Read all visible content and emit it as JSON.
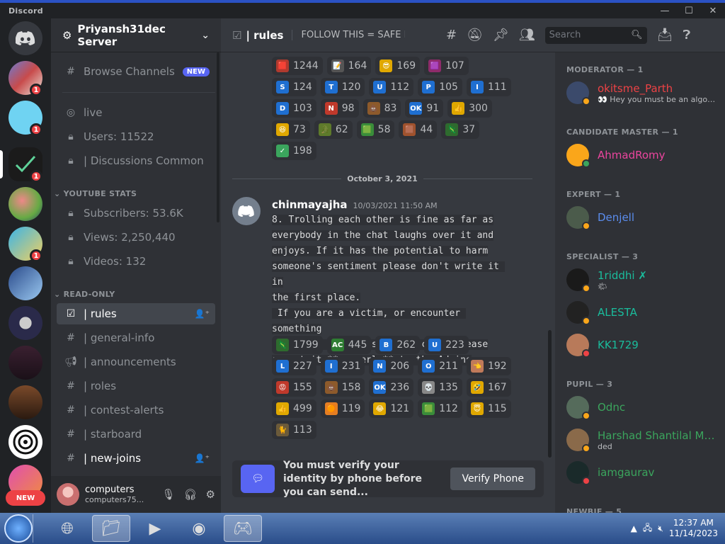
{
  "window": {
    "app_name": "Discord",
    "minimize": "—",
    "maximize": "☐",
    "close": "✕"
  },
  "server": {
    "name": "Priyansh31dec Server"
  },
  "rail": {
    "new_label": "NEW",
    "badges": [
      "1",
      "1",
      "1",
      "1"
    ]
  },
  "sidebar": {
    "browse": {
      "label": "Browse Channels",
      "tag": "NEW"
    },
    "channels_top": [
      {
        "label": "live"
      },
      {
        "label": "Users: 11522"
      },
      {
        "label": "| Discussions Common"
      }
    ],
    "cat_youtube": "YOUTUBE STATS",
    "youtube": [
      {
        "label": "Subscribers: 53.6K"
      },
      {
        "label": "Views: 2,250,440"
      },
      {
        "label": "Videos: 132"
      }
    ],
    "cat_readonly": "READ-ONLY",
    "readonly": [
      {
        "label": "| rules"
      },
      {
        "label": "| general-info"
      },
      {
        "label": "| announcements"
      },
      {
        "label": "| roles"
      },
      {
        "label": "| contest-alerts"
      },
      {
        "label": "| starboard"
      },
      {
        "label": "| new-joins"
      }
    ]
  },
  "user": {
    "name": "computers",
    "status": "computers75..."
  },
  "header": {
    "channel": "| rules",
    "topic": "FOLLOW THIS = SAFE D...",
    "search_placeholder": "Search"
  },
  "reactions_top": [
    [
      {
        "e": "🟥",
        "c": "#b03a2e",
        "v": "1244"
      },
      {
        "e": "📝",
        "c": "#555",
        "v": "164"
      },
      {
        "e": "😎",
        "c": "#e0a800",
        "v": "169"
      },
      {
        "e": "🟪",
        "c": "#8e2b6b",
        "v": "107"
      }
    ],
    [
      {
        "e": "S",
        "c": "#1f6fd1",
        "v": "124"
      },
      {
        "e": "T",
        "c": "#1f6fd1",
        "v": "120"
      },
      {
        "e": "U",
        "c": "#1f6fd1",
        "v": "112"
      },
      {
        "e": "P",
        "c": "#1f6fd1",
        "v": "105"
      },
      {
        "e": "I",
        "c": "#1f6fd1",
        "v": "111"
      }
    ],
    [
      {
        "e": "D",
        "c": "#1f6fd1",
        "v": "103"
      },
      {
        "e": "N",
        "c": "#c0392b",
        "v": "98"
      },
      {
        "e": "💩",
        "c": "#8d5a2b",
        "v": "83"
      },
      {
        "e": "OK",
        "c": "#1f6fd1",
        "v": "91"
      },
      {
        "e": "👍",
        "c": "#e0a800",
        "v": "300"
      }
    ],
    [
      {
        "e": "😆",
        "c": "#e0a800",
        "v": "73"
      },
      {
        "e": "🐊",
        "c": "#5e7a2b",
        "v": "62"
      },
      {
        "e": "🟩",
        "c": "#3a8d3a",
        "v": "58"
      },
      {
        "e": "🟫",
        "c": "#a0522d",
        "v": "44"
      },
      {
        "e": "🦎",
        "c": "#2e6b2e",
        "v": "37"
      }
    ],
    [
      {
        "e": "✓",
        "c": "#3ba55d",
        "v": "198"
      }
    ]
  ],
  "date_divider": "October 3, 2021",
  "message": {
    "author": "chinmayajha",
    "timestamp": "10/03/2021 11:50 AM",
    "lines": [
      "8. Trolling each other is fine as far as",
      "everybody in the chat laughs over it and",
      "enjoys. If it has the potential to harm",
      "someone's sentiment please don't write it in",
      "the first place.",
      " If you are a victim, or encounter something",
      "happening like this in the chat, please",
      "report it **properly** to the Admins"
    ]
  },
  "reactions_msg": [
    [
      {
        "e": "🦎",
        "c": "#2e6b2e",
        "v": "1799"
      },
      {
        "e": "AC",
        "c": "#2e7d32",
        "v": "445"
      },
      {
        "e": "B",
        "c": "#1f6fd1",
        "v": "262"
      },
      {
        "e": "U",
        "c": "#1f6fd1",
        "v": "223"
      }
    ],
    [
      {
        "e": "L",
        "c": "#1f6fd1",
        "v": "227"
      },
      {
        "e": "I",
        "c": "#1f6fd1",
        "v": "231"
      },
      {
        "e": "N",
        "c": "#1f6fd1",
        "v": "206"
      },
      {
        "e": "O",
        "c": "#1f6fd1",
        "v": "211"
      },
      {
        "e": "👈",
        "c": "#c07a5a",
        "v": "192"
      }
    ],
    [
      {
        "e": "😡",
        "c": "#c0392b",
        "v": "155"
      },
      {
        "e": "💩",
        "c": "#8d5a2b",
        "v": "158"
      },
      {
        "e": "OK",
        "c": "#1f6fd1",
        "v": "236"
      },
      {
        "e": "💀",
        "c": "#888",
        "v": "135"
      },
      {
        "e": "🤣",
        "c": "#e0a800",
        "v": "167"
      }
    ],
    [
      {
        "e": "👍",
        "c": "#e0a800",
        "v": "499"
      },
      {
        "e": "🟠",
        "c": "#e67e22",
        "v": "119"
      },
      {
        "e": "😂",
        "c": "#e0a800",
        "v": "121"
      },
      {
        "e": "🟩",
        "c": "#3a8d3a",
        "v": "112"
      },
      {
        "e": "😇",
        "c": "#e0a800",
        "v": "115"
      }
    ],
    [
      {
        "e": "🐈",
        "c": "#6b5a3a",
        "v": "113"
      }
    ]
  ],
  "verify": {
    "text": "You must verify your identity by phone before you can send...",
    "button": "Verify Phone"
  },
  "members": {
    "groups": [
      {
        "title": "MODERATOR — 1",
        "items": [
          {
            "name": "okitsme_Parth",
            "color": "#ed4245",
            "status_text": "👀 Hey you must be an algorit...",
            "av": "#3b4a6b",
            "st": "#faa61a"
          }
        ]
      },
      {
        "title": "CANDIDATE MASTER — 1",
        "items": [
          {
            "name": "AhmadRomy",
            "color": "#eb459e",
            "status_text": "",
            "av": "#faa61a",
            "st": "#3ba55d"
          }
        ]
      },
      {
        "title": "EXPERT — 1",
        "items": [
          {
            "name": "Denjell",
            "color": "#5b8dee",
            "status_text": "",
            "av": "#4b5b4b",
            "st": "#faa61a"
          }
        ]
      },
      {
        "title": "SPECIALIST — 3",
        "items": [
          {
            "name": "1riddhi ✗",
            "color": "#1abc9c",
            "status_text": "🌤",
            "av": "#1a1a1a",
            "st": "#faa61a"
          },
          {
            "name": "ALESTA",
            "color": "#1abc9c",
            "status_text": "",
            "av": "#222",
            "st": "#faa61a"
          },
          {
            "name": "KK1729",
            "color": "#1abc9c",
            "status_text": "",
            "av": "#b87a5a",
            "st": "#ed4245"
          }
        ]
      },
      {
        "title": "PUPIL — 3",
        "items": [
          {
            "name": "Odnc",
            "color": "#3ba55d",
            "status_text": "",
            "av": "#556b5b",
            "st": "#faa61a"
          },
          {
            "name": "Harshad Shantilal Me...",
            "color": "#3ba55d",
            "status_text": "ded",
            "av": "#8a6a4a",
            "st": "#faa61a"
          },
          {
            "name": "iamgaurav",
            "color": "#3ba55d",
            "status_text": "",
            "av": "#1a2a2a",
            "st": "#ed4245"
          }
        ]
      },
      {
        "title": "NEWBIE — 5",
        "items": []
      }
    ]
  },
  "taskbar": {
    "time": "12:37 AM",
    "date": "11/14/2023"
  }
}
